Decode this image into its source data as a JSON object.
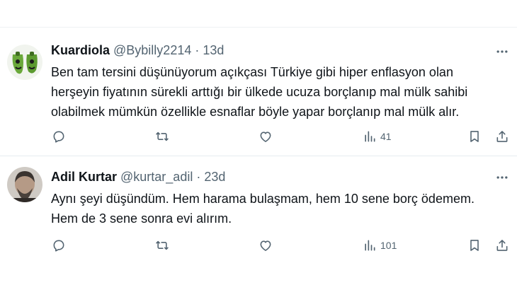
{
  "tweets": [
    {
      "name": "Kuardiola",
      "handle": "@Bybilly2214",
      "separator": "·",
      "time": "13d",
      "lines": [
        "Ben tam tersini düşünüyorum açıkçası Türkiye gibi hiper enflasyon olan",
        "herşeyin fiyatının sürekli arttığı  bir ülkede ucuza borçlanıp mal mülk sahibi",
        "olabilmek mümkün özellikle esnaflar böyle yapar borçlanıp mal mülk alır."
      ],
      "views": "41",
      "avatar_icon": "green-peppers-avatar"
    },
    {
      "name": "Adil Kurtar",
      "handle": "@kurtar_adil",
      "separator": "·",
      "time": "23d",
      "lines": [
        "Aynı şeyi düşündüm. Hem harama bulaşmam, hem 10 sene borç ödemem.",
        "Hem de 3 sene sonra evi alırım."
      ],
      "views": "101",
      "avatar_icon": "profile-photo-avatar"
    }
  ],
  "icons": {
    "more": "more-horizontal-icon",
    "reply": "reply-icon",
    "retweet": "retweet-icon",
    "like": "like-icon",
    "views": "views-icon",
    "bookmark": "bookmark-icon",
    "share": "share-icon"
  },
  "colors": {
    "text": "#0f1419",
    "secondary": "#536471",
    "divider": "#e6ecf0"
  }
}
